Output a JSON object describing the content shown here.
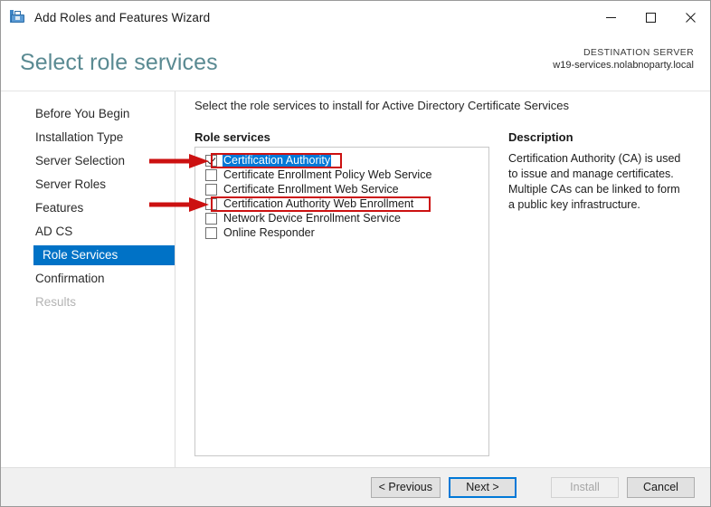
{
  "window": {
    "title": "Add Roles and Features Wizard",
    "app_icon": "server-manager-icon",
    "minimize_glyph": "minimize-icon",
    "maximize_glyph": "maximize-icon",
    "close_glyph": "close-icon"
  },
  "header": {
    "page_title": "Select role services",
    "destination_label": "DESTINATION SERVER",
    "destination_server": "w19-services.nolabnoparty.local",
    "title_color": "#5a8a92"
  },
  "sidebar": {
    "items": [
      {
        "label": "Before You Begin",
        "state": "normal"
      },
      {
        "label": "Installation Type",
        "state": "normal"
      },
      {
        "label": "Server Selection",
        "state": "normal"
      },
      {
        "label": "Server Roles",
        "state": "normal"
      },
      {
        "label": "Features",
        "state": "normal"
      },
      {
        "label": "AD CS",
        "state": "normal"
      },
      {
        "label": "Role Services",
        "state": "selected"
      },
      {
        "label": "Confirmation",
        "state": "normal"
      },
      {
        "label": "Results",
        "state": "disabled"
      }
    ],
    "selected_color": "#0072c6"
  },
  "main": {
    "instruction": "Select the role services to install for Active Directory Certificate Services",
    "section_label": "Role services",
    "role_services": [
      {
        "label": "Certification Authority",
        "checked": true,
        "selected": true,
        "annotated": true
      },
      {
        "label": "Certificate Enrollment Policy Web Service",
        "checked": false,
        "selected": false,
        "annotated": false
      },
      {
        "label": "Certificate Enrollment Web Service",
        "checked": false,
        "selected": false,
        "annotated": false
      },
      {
        "label": "Certification Authority Web Enrollment",
        "checked": false,
        "selected": false,
        "annotated": true
      },
      {
        "label": "Network Device Enrollment Service",
        "checked": false,
        "selected": false,
        "annotated": false
      },
      {
        "label": "Online Responder",
        "checked": false,
        "selected": false,
        "annotated": false
      }
    ],
    "selection_color": "#0078d7"
  },
  "description": {
    "title": "Description",
    "text": "Certification Authority (CA) is used to issue and manage certificates. Multiple CAs can be linked to form a public key infrastructure."
  },
  "annotations": {
    "color": "#cc1111",
    "arrows": [
      {
        "name": "arrow-certification-authority"
      },
      {
        "name": "arrow-certification-authority-web-enrollment"
      }
    ]
  },
  "footer": {
    "previous_label": "< Previous",
    "next_label": "Next >",
    "install_label": "Install",
    "cancel_label": "Cancel"
  }
}
